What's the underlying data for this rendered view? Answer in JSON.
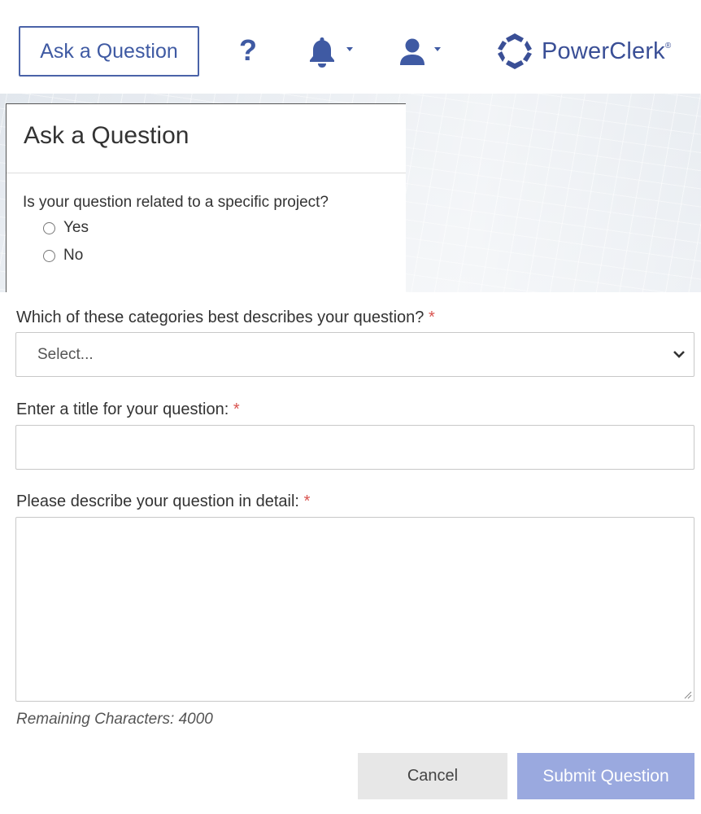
{
  "header": {
    "ask_button_label": "Ask a Question",
    "help_icon_glyph": "?",
    "notifications_icon": "bell-icon",
    "user_icon": "user-icon",
    "logo_text": "PowerClerk",
    "logo_mark": "®"
  },
  "modal": {
    "title": "Ask a Question",
    "project_question": "Is your question related to a specific project?",
    "project_options": [
      {
        "label": "Yes",
        "selected": false
      },
      {
        "label": "No",
        "selected": false
      }
    ]
  },
  "form": {
    "category_label": "Which of these categories best describes your question?",
    "category_value": "Select...",
    "title_label": "Enter a title for your question:",
    "title_value": "",
    "detail_label": "Please describe your question in detail:",
    "detail_value": "",
    "required_marker": "*",
    "remaining_text": "Remaining Characters: 4000",
    "cancel_label": "Cancel",
    "submit_label": "Submit Question"
  },
  "colors": {
    "brand": "#3f5aa3",
    "submit_bg": "#9aa9df",
    "cancel_bg": "#e7e7e7",
    "required": "#d9534f"
  }
}
